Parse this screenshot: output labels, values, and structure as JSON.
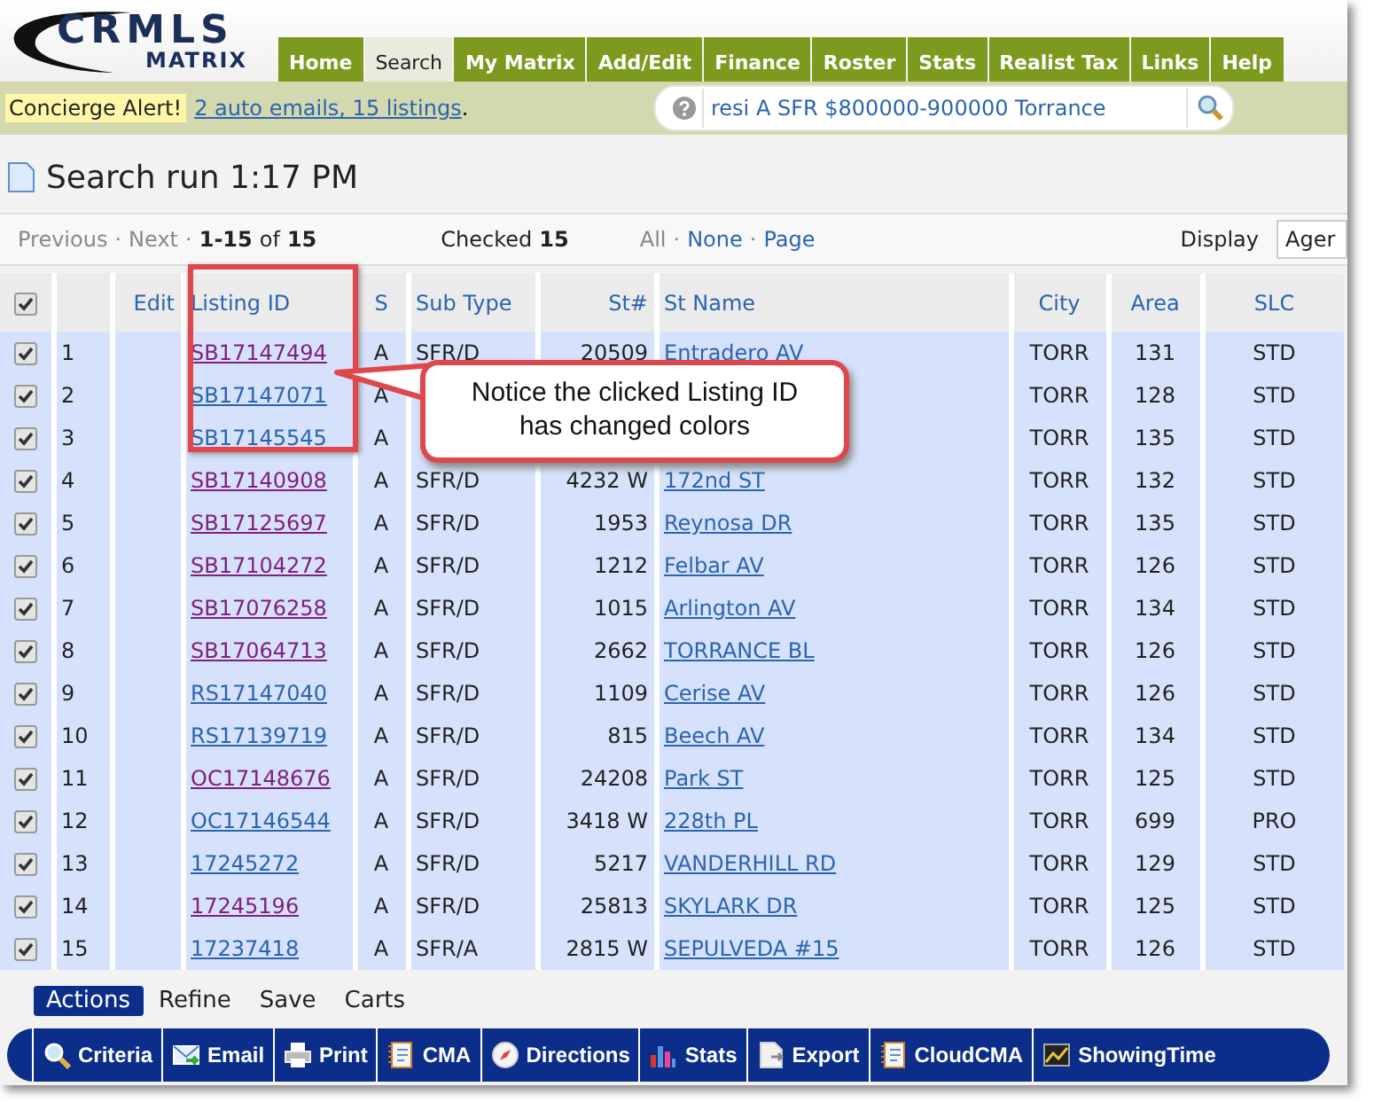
{
  "logo": {
    "line1": "CRMLS",
    "line2": "MATRIX"
  },
  "nav_tabs": [
    {
      "label": "Home",
      "selected": false
    },
    {
      "label": "Search",
      "selected": true
    },
    {
      "label": "My Matrix",
      "selected": false
    },
    {
      "label": "Add/Edit",
      "selected": false
    },
    {
      "label": "Finance",
      "selected": false
    },
    {
      "label": "Roster",
      "selected": false
    },
    {
      "label": "Stats",
      "selected": false
    },
    {
      "label": "Realist Tax",
      "selected": false
    },
    {
      "label": "Links",
      "selected": false
    },
    {
      "label": "Help",
      "selected": false
    }
  ],
  "alert": {
    "label": "Concierge Alert!",
    "link": "2 auto emails, 15 listings",
    "suffix": "."
  },
  "quick_search": {
    "value": "resi A SFR $800000-900000 Torrance"
  },
  "title": "Search run 1:17 PM",
  "pager": {
    "separator": "·",
    "previous": "Previous",
    "next": "Next",
    "range": "1-15",
    "of": "of",
    "total": "15",
    "checked_label": "Checked",
    "checked_count": "15",
    "all": "All",
    "none": "None",
    "page": "Page",
    "display_label": "Display",
    "display_value": "Ager"
  },
  "table": {
    "select_all_checked": true,
    "columns": [
      "Edit",
      "Listing ID",
      "S",
      "Sub Type",
      "St#",
      "St Name",
      "City",
      "Area",
      "SLC"
    ],
    "rows": [
      {
        "checked": true,
        "num": "1",
        "listing_id": "SB17147494",
        "visited": true,
        "s": "A",
        "sub_type": "SFR/D",
        "st_no": "20509",
        "st_name": "Entradero AV",
        "city": "TORR",
        "area": "131",
        "slc": "STD"
      },
      {
        "checked": true,
        "num": "2",
        "listing_id": "SB17147071",
        "visited": false,
        "s": "A",
        "city": "TORR",
        "area": "128",
        "slc": "STD"
      },
      {
        "checked": true,
        "num": "3",
        "listing_id": "SB17145545",
        "visited": false,
        "s": "A",
        "city": "TORR",
        "area": "135",
        "slc": "STD"
      },
      {
        "checked": true,
        "num": "4",
        "listing_id": "SB17140908",
        "visited": true,
        "s": "A",
        "sub_type": "SFR/D",
        "st_no": "4232 W",
        "st_name": "172nd ST",
        "city": "TORR",
        "area": "132",
        "slc": "STD"
      },
      {
        "checked": true,
        "num": "5",
        "listing_id": "SB17125697",
        "visited": true,
        "s": "A",
        "sub_type": "SFR/D",
        "st_no": "1953",
        "st_name": "Reynosa DR",
        "city": "TORR",
        "area": "135",
        "slc": "STD"
      },
      {
        "checked": true,
        "num": "6",
        "listing_id": "SB17104272",
        "visited": true,
        "s": "A",
        "sub_type": "SFR/D",
        "st_no": "1212",
        "st_name": "Felbar AV",
        "city": "TORR",
        "area": "126",
        "slc": "STD"
      },
      {
        "checked": true,
        "num": "7",
        "listing_id": "SB17076258",
        "visited": true,
        "s": "A",
        "sub_type": "SFR/D",
        "st_no": "1015",
        "st_name": "Arlington AV",
        "city": "TORR",
        "area": "134",
        "slc": "STD"
      },
      {
        "checked": true,
        "num": "8",
        "listing_id": "SB17064713",
        "visited": true,
        "s": "A",
        "sub_type": "SFR/D",
        "st_no": "2662",
        "st_name": "TORRANCE BL",
        "city": "TORR",
        "area": "126",
        "slc": "STD"
      },
      {
        "checked": true,
        "num": "9",
        "listing_id": "RS17147040",
        "visited": false,
        "s": "A",
        "sub_type": "SFR/D",
        "st_no": "1109",
        "st_name": "Cerise AV",
        "city": "TORR",
        "area": "126",
        "slc": "STD"
      },
      {
        "checked": true,
        "num": "10",
        "listing_id": "RS17139719",
        "visited": false,
        "s": "A",
        "sub_type": "SFR/D",
        "st_no": "815",
        "st_name": "Beech AV",
        "city": "TORR",
        "area": "134",
        "slc": "STD"
      },
      {
        "checked": true,
        "num": "11",
        "listing_id": "OC17148676",
        "visited": true,
        "s": "A",
        "sub_type": "SFR/D",
        "st_no": "24208",
        "st_name": "Park ST",
        "city": "TORR",
        "area": "125",
        "slc": "STD"
      },
      {
        "checked": true,
        "num": "12",
        "listing_id": "OC17146544",
        "visited": false,
        "s": "A",
        "sub_type": "SFR/D",
        "st_no": "3418 W",
        "st_name": "228th PL",
        "city": "TORR",
        "area": "699",
        "slc": "PRO"
      },
      {
        "checked": true,
        "num": "13",
        "listing_id": "17245272",
        "visited": false,
        "s": "A",
        "sub_type": "SFR/D",
        "st_no": "5217",
        "st_name": "VANDERHILL RD",
        "city": "TORR",
        "area": "129",
        "slc": "STD"
      },
      {
        "checked": true,
        "num": "14",
        "listing_id": "17245196",
        "visited": true,
        "s": "A",
        "sub_type": "SFR/D",
        "st_no": "25813",
        "st_name": "SKYLARK DR",
        "city": "TORR",
        "area": "125",
        "slc": "STD"
      },
      {
        "checked": true,
        "num": "15",
        "listing_id": "17237418",
        "visited": false,
        "s": "A",
        "sub_type": "SFR/A",
        "st_no": "2815 W",
        "st_name": "SEPULVEDA #15",
        "city": "TORR",
        "area": "126",
        "slc": "STD"
      }
    ]
  },
  "callout": {
    "text": "Notice the clicked Listing ID has changed colors"
  },
  "action_tabs": [
    {
      "label": "Actions",
      "selected": true
    },
    {
      "label": "Refine",
      "selected": false
    },
    {
      "label": "Save",
      "selected": false
    },
    {
      "label": "Carts",
      "selected": false
    }
  ],
  "toolbar": [
    "Criteria",
    "Email",
    "Print",
    "CMA",
    "Directions",
    "Stats",
    "Export",
    "CloudCMA",
    "ShowingTime"
  ]
}
